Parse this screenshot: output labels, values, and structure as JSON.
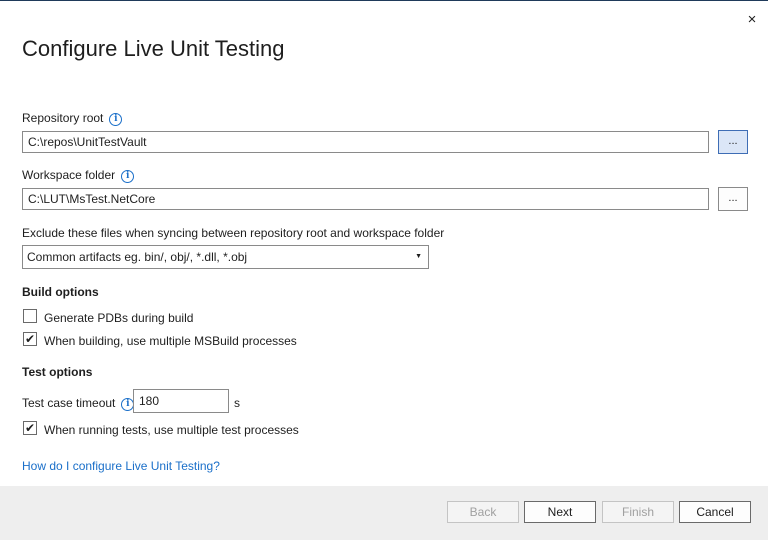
{
  "dialog": {
    "title": "Configure Live Unit Testing",
    "close_glyph": "×"
  },
  "repo_root": {
    "label": "Repository root",
    "value": "C:\\repos\\UnitTestVault",
    "browse_label": "..."
  },
  "workspace": {
    "label": "Workspace folder",
    "value": "C:\\LUT\\MsTest.NetCore",
    "browse_label": "..."
  },
  "exclude": {
    "label": "Exclude these files when syncing between repository root and workspace folder",
    "selected": "Common artifacts eg. bin/, obj/, *.dll, *.obj"
  },
  "build_options": {
    "heading": "Build options",
    "items": [
      {
        "label": "Generate PDBs during build",
        "checked": false
      },
      {
        "label": "When building, use multiple MSBuild processes",
        "checked": true
      }
    ]
  },
  "test_options": {
    "heading": "Test options",
    "timeout_label": "Test case timeout",
    "timeout_value": "180",
    "timeout_unit": "s",
    "multi_process": {
      "label": "When running tests, use multiple test processes",
      "checked": true
    }
  },
  "help_link": "How do I configure Live Unit Testing?",
  "buttons": {
    "back": "Back",
    "next": "Next",
    "finish": "Finish",
    "cancel": "Cancel"
  },
  "icons": {
    "info": "info-icon",
    "checkmark": "✔",
    "caret": "▼"
  },
  "colors": {
    "accent": "#1a6fc9",
    "footer": "#eeeeee"
  }
}
